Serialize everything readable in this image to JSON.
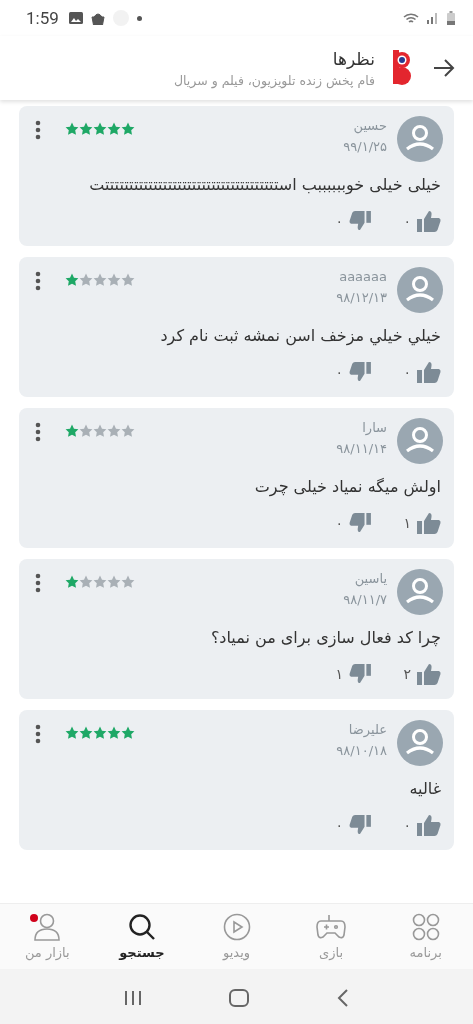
{
  "status_bar": {
    "time": "1:59"
  },
  "header": {
    "title": "نظرها",
    "subtitle": "فام پخش زنده تلویزیون، فیلم و سریال"
  },
  "reviews": [
    {
      "name": "حسین",
      "date": "۹۹/۱/۲۵",
      "stars": 5,
      "text": "خیلی خیلی خوببببببب استتتتتتتتتتتتتتتتتتتتتتتتتتتتتتتتتتتتت",
      "likes": "۰",
      "dislikes": "۰"
    },
    {
      "name": "aaaaaa",
      "date": "۹۸/۱۲/۱۳",
      "stars": 1,
      "text": "خيلي خيلي مزخف اسن نمشه ثبت نام کرد",
      "likes": "۰",
      "dislikes": "۰"
    },
    {
      "name": "سارا",
      "date": "۹۸/۱۱/۱۴",
      "stars": 1,
      "text": "اولش میگه نمیاد خیلی چرت",
      "likes": "۱",
      "dislikes": "۰"
    },
    {
      "name": "یاسین",
      "date": "۹۸/۱۱/۷",
      "stars": 1,
      "text": "چرا کد فعال سازی برای من نمیاد؟",
      "likes": "۲",
      "dislikes": "۱"
    },
    {
      "name": "علیرضا",
      "date": "۹۸/۱۰/۱۸",
      "stars": 5,
      "text": "غالیه",
      "likes": "۰",
      "dislikes": "۰"
    }
  ],
  "bottom_nav": [
    {
      "label": "برنامه",
      "kind": "apps",
      "selected": false,
      "badge": false
    },
    {
      "label": "بازی",
      "kind": "games",
      "selected": false,
      "badge": false
    },
    {
      "label": "ویدیو",
      "kind": "video",
      "selected": false,
      "badge": false
    },
    {
      "label": "جستجو",
      "kind": "search",
      "selected": true,
      "badge": false
    },
    {
      "label": "بازار من",
      "kind": "profile",
      "selected": false,
      "badge": true
    }
  ]
}
